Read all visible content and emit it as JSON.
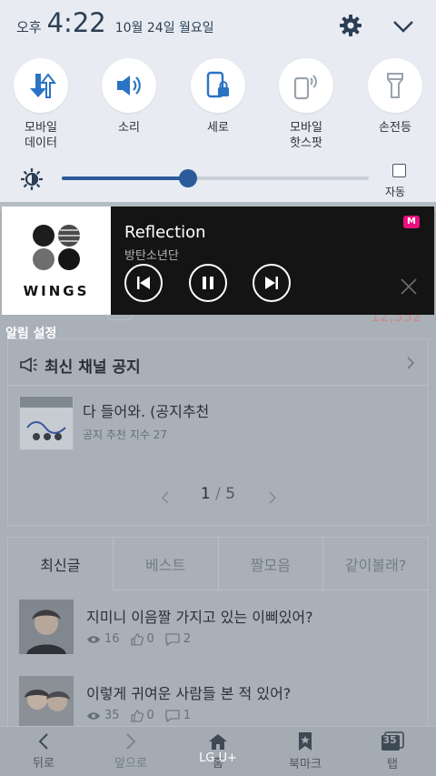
{
  "status": {
    "ampm": "오후",
    "time": "4:22",
    "date": "10월 24일 월요일"
  },
  "quick_settings": [
    {
      "icon": "mobile-data-icon",
      "label": "모바일\n데이터"
    },
    {
      "icon": "sound-icon",
      "label": "소리"
    },
    {
      "icon": "rotation-lock-icon",
      "label": "세로"
    },
    {
      "icon": "mobile-hotspot-icon",
      "label": "모바일\n핫스팟"
    },
    {
      "icon": "flashlight-icon",
      "label": "손전등"
    }
  ],
  "brightness": {
    "level": 0.41,
    "auto_label": "자동",
    "auto_checked": false
  },
  "music": {
    "album_text": "WINGS",
    "title": "Reflection",
    "artist": "방탄소년단",
    "app_logo": "M"
  },
  "alarm_settings_label": "알림 설정",
  "background": {
    "count": "12,552",
    "notice": {
      "header": "최신 채널 공지",
      "title": "다 들어와. (공지추천",
      "subtitle": "공지 추천 지수 27",
      "page_current": "1",
      "page_sep": "/",
      "page_total": "5"
    },
    "tabs": [
      "최신글",
      "베스트",
      "짤모음",
      "같이볼래?"
    ],
    "posts": [
      {
        "title": "지미니 이음짤 가지고 있는 이삐있어?",
        "views": "16",
        "likes": "0",
        "comments": "2"
      },
      {
        "title": "이렇게 귀여운 사람들 본 적 있어?",
        "views": "35",
        "likes": "0",
        "comments": "1"
      }
    ],
    "bottom_nav": [
      {
        "icon": "back-icon",
        "label": "뒤로"
      },
      {
        "icon": "forward-icon",
        "label": "앞으로"
      },
      {
        "icon": "home-icon",
        "label": "홈"
      },
      {
        "icon": "bookmark-icon",
        "label": "북마크"
      },
      {
        "icon": "tabs-icon",
        "label": "탭",
        "count": "35"
      }
    ],
    "carrier": "LG U+"
  },
  "colors": {
    "accent": "#2b5b9a",
    "music_bg": "#141414",
    "mnet": "#e8107d"
  }
}
